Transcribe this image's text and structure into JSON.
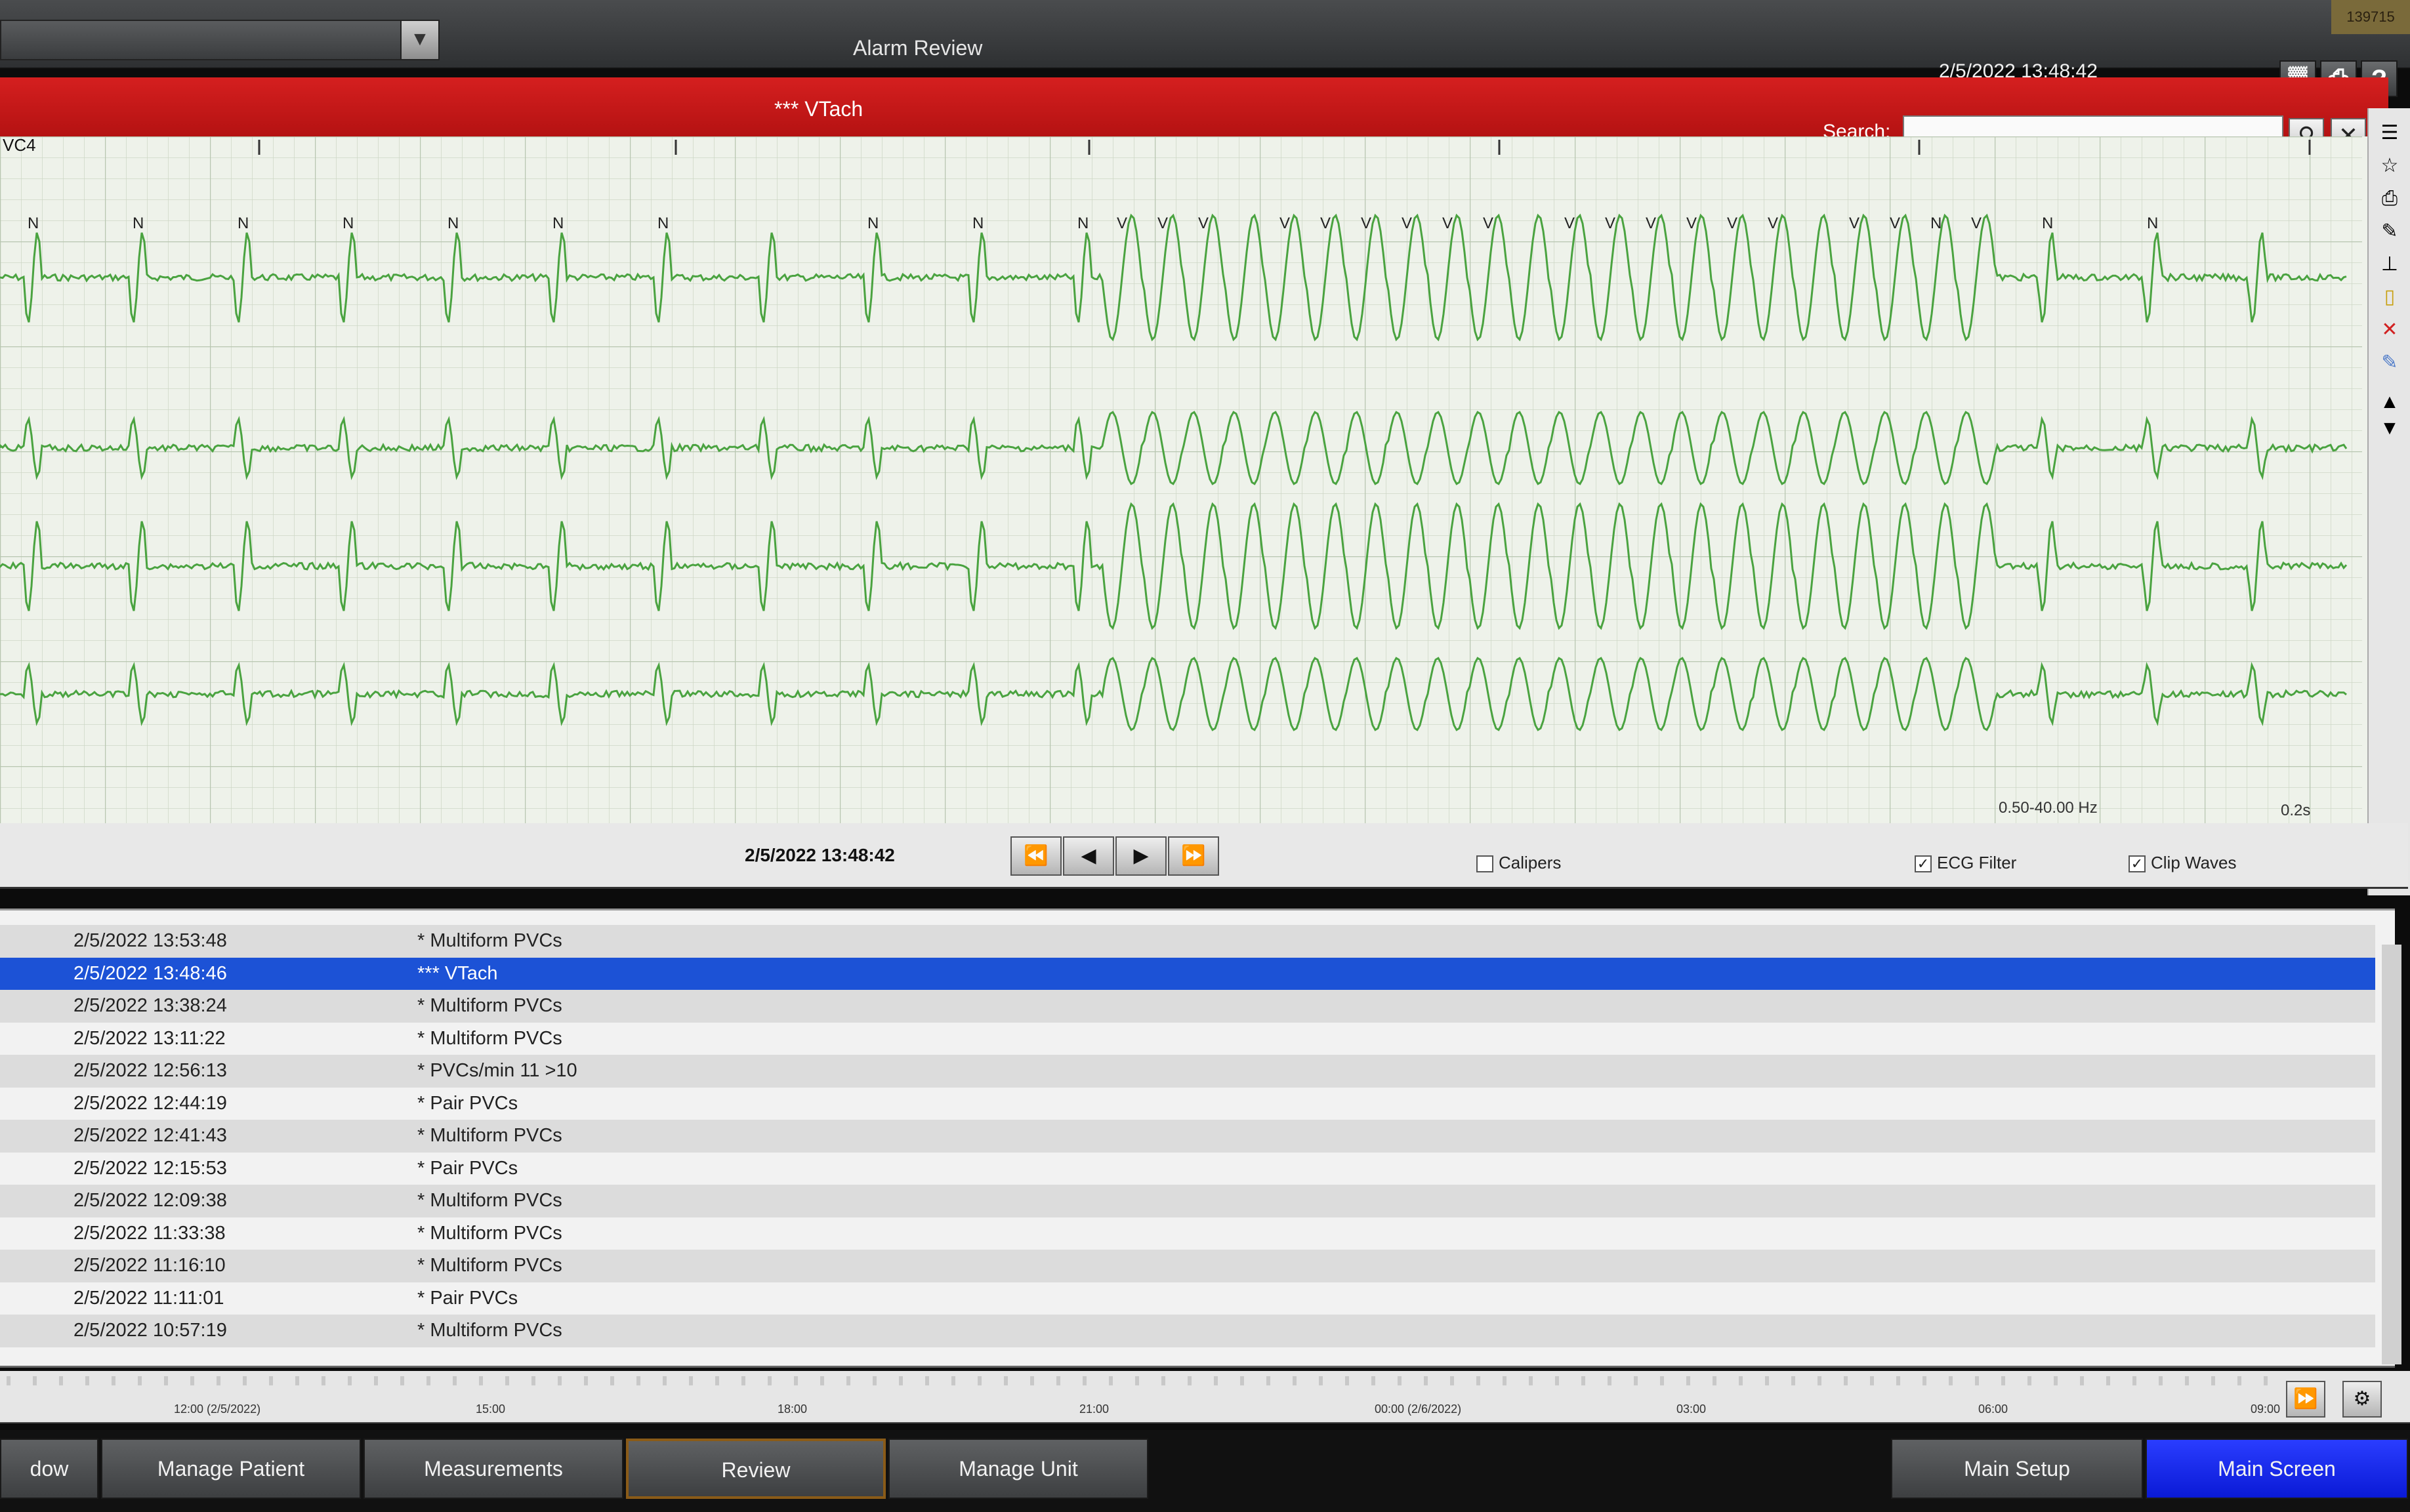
{
  "window": {
    "title": "Alarm Review",
    "timestamp": "2/5/2022 13:48:42",
    "corner_badge": "139715",
    "unit_select_value": ""
  },
  "alarm_header": {
    "alarm_name": "*** VTach",
    "search_label": "Search:",
    "search_value": "",
    "lead_label": "VC4"
  },
  "ecg": {
    "filter": "0.50-40.00 Hz",
    "scale": "0.2s",
    "strip_time": "2/5/2022 13:48:42",
    "beat_labels": [
      "N",
      "N",
      "N",
      "N",
      "N",
      "N",
      "N",
      "N",
      "N",
      "N",
      "V",
      "V",
      "V",
      "V",
      "V",
      "V",
      "V",
      "V",
      "V",
      "V",
      "V",
      "V",
      "V",
      "V",
      "V",
      "V",
      "V",
      "N",
      "V",
      "N",
      "N"
    ],
    "trace_color": "#4aa340"
  },
  "controls": {
    "calipers_label": "Calipers",
    "calipers_checked": false,
    "ecg_filter_label": "ECG Filter",
    "ecg_filter_checked": true,
    "clip_waves_label": "Clip Waves",
    "clip_waves_checked": true
  },
  "events": [
    {
      "time": "2/5/2022 13:53:48",
      "name": "* Multiform PVCs"
    },
    {
      "time": "2/5/2022 13:48:46",
      "name": "*** VTach"
    },
    {
      "time": "2/5/2022 13:38:24",
      "name": "* Multiform PVCs"
    },
    {
      "time": "2/5/2022 13:11:22",
      "name": "* Multiform PVCs"
    },
    {
      "time": "2/5/2022 12:56:13",
      "name": "* PVCs/min 11 >10"
    },
    {
      "time": "2/5/2022 12:44:19",
      "name": "* Pair PVCs"
    },
    {
      "time": "2/5/2022 12:41:43",
      "name": "* Multiform PVCs"
    },
    {
      "time": "2/5/2022 12:15:53",
      "name": "* Pair PVCs"
    },
    {
      "time": "2/5/2022 12:09:38",
      "name": "* Multiform PVCs"
    },
    {
      "time": "2/5/2022 11:33:38",
      "name": "* Multiform PVCs"
    },
    {
      "time": "2/5/2022 11:16:10",
      "name": "* Multiform PVCs"
    },
    {
      "time": "2/5/2022 11:11:01",
      "name": "* Pair PVCs"
    },
    {
      "time": "2/5/2022 10:57:19",
      "name": "* Multiform PVCs"
    }
  ],
  "timeline": {
    "labels": [
      "12:00 (2/5/2022)",
      "15:00",
      "18:00",
      "21:00",
      "00:00 (2/6/2022)",
      "03:00",
      "06:00",
      "09:00"
    ]
  },
  "bottom_nav": {
    "window": "dow",
    "manage_patient": "Manage Patient",
    "measurements": "Measurements",
    "review": "Review",
    "manage_unit": "Manage Unit",
    "main_setup": "Main Setup",
    "main_screen": "Main Screen"
  }
}
